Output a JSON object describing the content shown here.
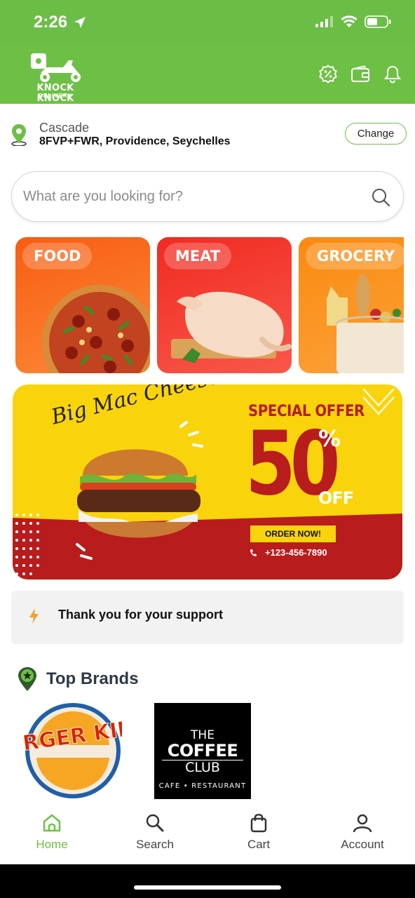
{
  "status_bar": {
    "time": "2:26"
  },
  "app": {
    "logo_name": "KNOCK KNOCK",
    "logo_tagline": "DELIVERY",
    "header_icons": [
      "offers-percent-icon",
      "wallet-icon",
      "notification-bell-icon"
    ],
    "brand_color": "#6ec045"
  },
  "location": {
    "name": "Cascade",
    "address": "8FVP+FWR, Providence, Seychelles",
    "change_label": "Change"
  },
  "search": {
    "placeholder": "What are you looking for?",
    "value": ""
  },
  "categories": [
    {
      "label": "FOOD",
      "color": "#f96a1e"
    },
    {
      "label": "MEAT",
      "color": "#f4322c"
    },
    {
      "label": "GROCERY",
      "color": "#fb9416"
    }
  ],
  "promo": {
    "script_title": "Big Mac Cheese",
    "special_offer": "SPECIAL OFFER",
    "discount_number": "50",
    "percent": "%",
    "off": "OFF",
    "button_label": "ORDER NOW!",
    "phone": "+123-456-7890"
  },
  "notice": {
    "text": "Thank you for your support"
  },
  "top_brands": {
    "title": "Top Brands",
    "brands": [
      {
        "name": "BURGER KING"
      },
      {
        "line1": "THE",
        "line2": "COFFEE",
        "line3": "CLUB",
        "tagline": "CAFE • RESTAURANT"
      }
    ]
  },
  "bottom_nav": {
    "items": [
      {
        "label": "Home",
        "icon": "home-icon",
        "active": true
      },
      {
        "label": "Search",
        "icon": "search-icon",
        "active": false
      },
      {
        "label": "Cart",
        "icon": "cart-bag-icon",
        "active": false
      },
      {
        "label": "Account",
        "icon": "account-icon",
        "active": false
      }
    ]
  }
}
